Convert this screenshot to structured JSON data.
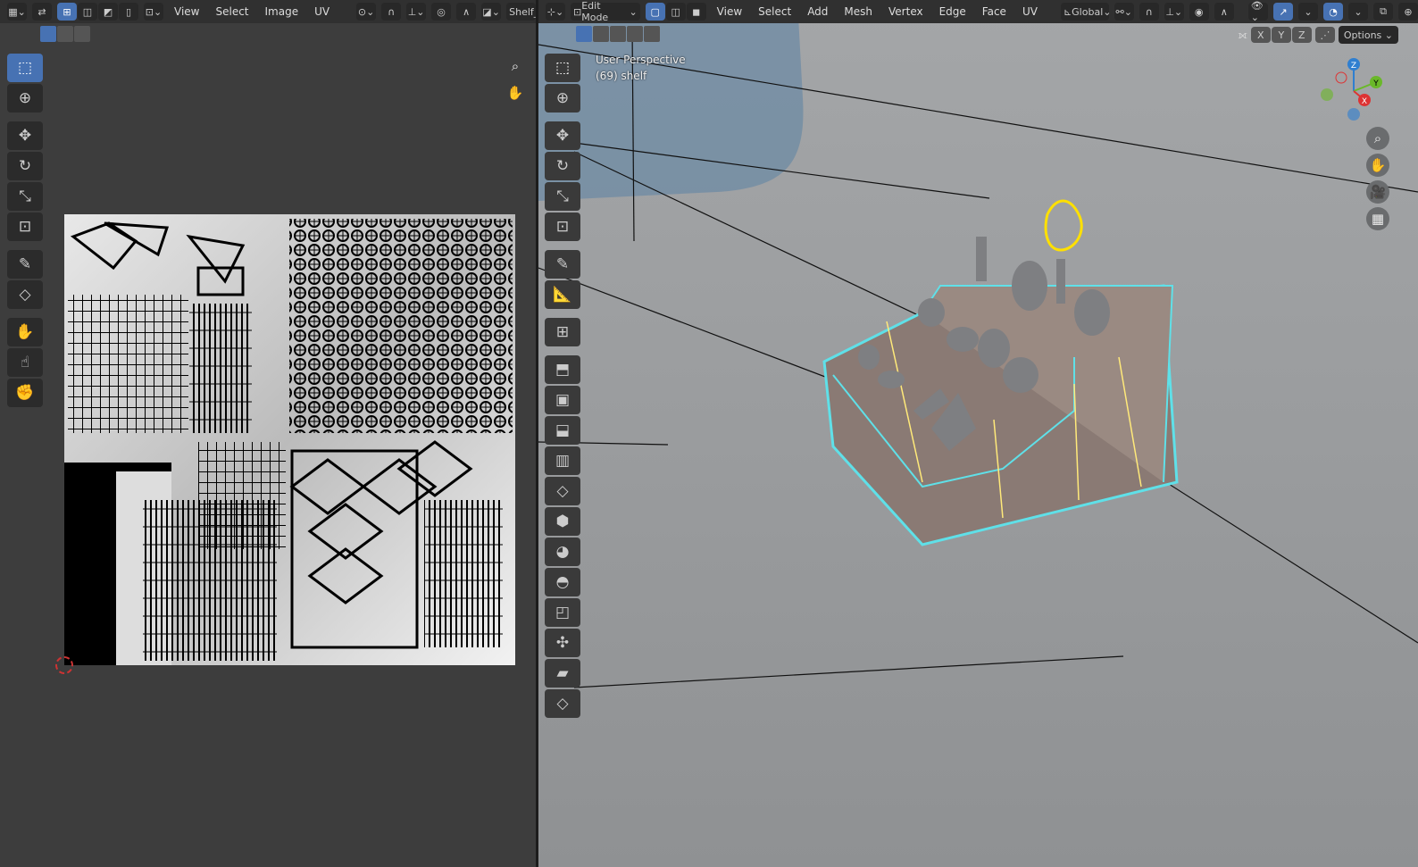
{
  "uv_editor": {
    "menus": [
      "View",
      "Select",
      "Image",
      "UV"
    ],
    "image_name": "Shelf_Def",
    "tools": [
      "select-box",
      "cursor",
      "move",
      "rotate",
      "scale",
      "transform",
      "annotate",
      "rip",
      "grab",
      "relax",
      "pinch"
    ]
  },
  "viewport": {
    "mode": "Edit Mode",
    "menus": [
      "View",
      "Select",
      "Add",
      "Mesh",
      "Vertex",
      "Edge",
      "Face",
      "UV"
    ],
    "orientation": "Global",
    "mirror_axes": [
      "X",
      "Y",
      "Z"
    ],
    "options_label": "Options",
    "view_name": "User Perspective",
    "object_info": "(69) shelf",
    "gizmo_axes": {
      "x": "X",
      "y": "Y",
      "z": "Z"
    },
    "colors": {
      "accent": "#4772b3",
      "edge_select": "#5fe0e8",
      "vertex": "#ffe000",
      "face": "#8a7a74"
    }
  }
}
